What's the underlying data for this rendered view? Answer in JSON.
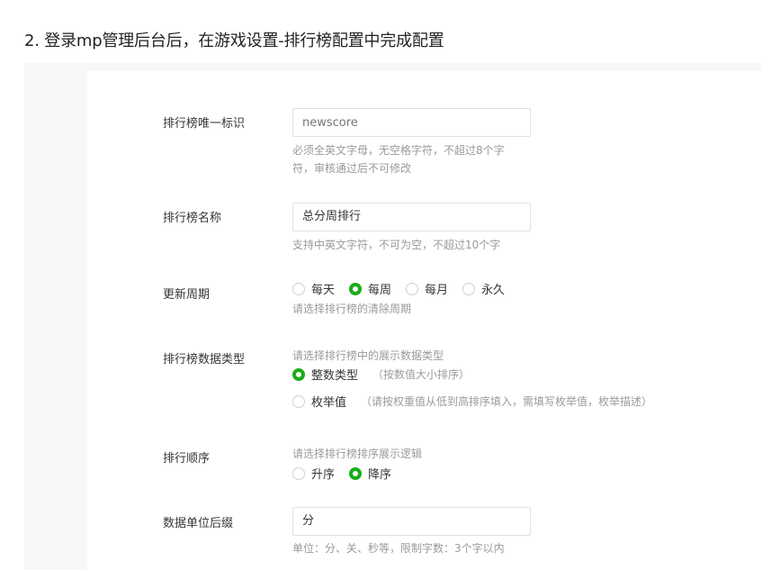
{
  "heading": "2. 登录mp管理后台后，在游戏设置-排行榜配置中完成配置",
  "form": {
    "unique_id": {
      "label": "排行榜唯一标识",
      "placeholder": "newscore",
      "hint_line1": "必须全英文字母，无空格字符，不超过8个字",
      "hint_line2": "符，审核通过后不可修改"
    },
    "name": {
      "label": "排行榜名称",
      "value": "总分周排行",
      "hint": "支持中英文字符，不可为空，不超过10个字"
    },
    "period": {
      "label": "更新周期",
      "options": [
        "每天",
        "每周",
        "每月",
        "永久"
      ],
      "selected": "每周",
      "hint": "请选择排行榜的清除周期"
    },
    "data_type": {
      "label": "排行榜数据类型",
      "hint": "请选择排行榜中的展示数据类型",
      "options": [
        {
          "label": "整数类型",
          "note": "（按数值大小排序）"
        },
        {
          "label": "枚举值",
          "note": "（请按权重值从低到高排序填入，需填写枚举值，枚举描述）"
        }
      ],
      "selected": "整数类型"
    },
    "order": {
      "label": "排行顺序",
      "hint": "请选择排行榜排序展示逻辑",
      "options": [
        "升序",
        "降序"
      ],
      "selected": "降序"
    },
    "unit": {
      "label": "数据单位后缀",
      "value": "分",
      "hint": "单位：分、关、秒等，限制字数：3个字以内"
    }
  },
  "colors": {
    "accent": "#1aad19",
    "panel_bg": "#f6f7f9"
  }
}
